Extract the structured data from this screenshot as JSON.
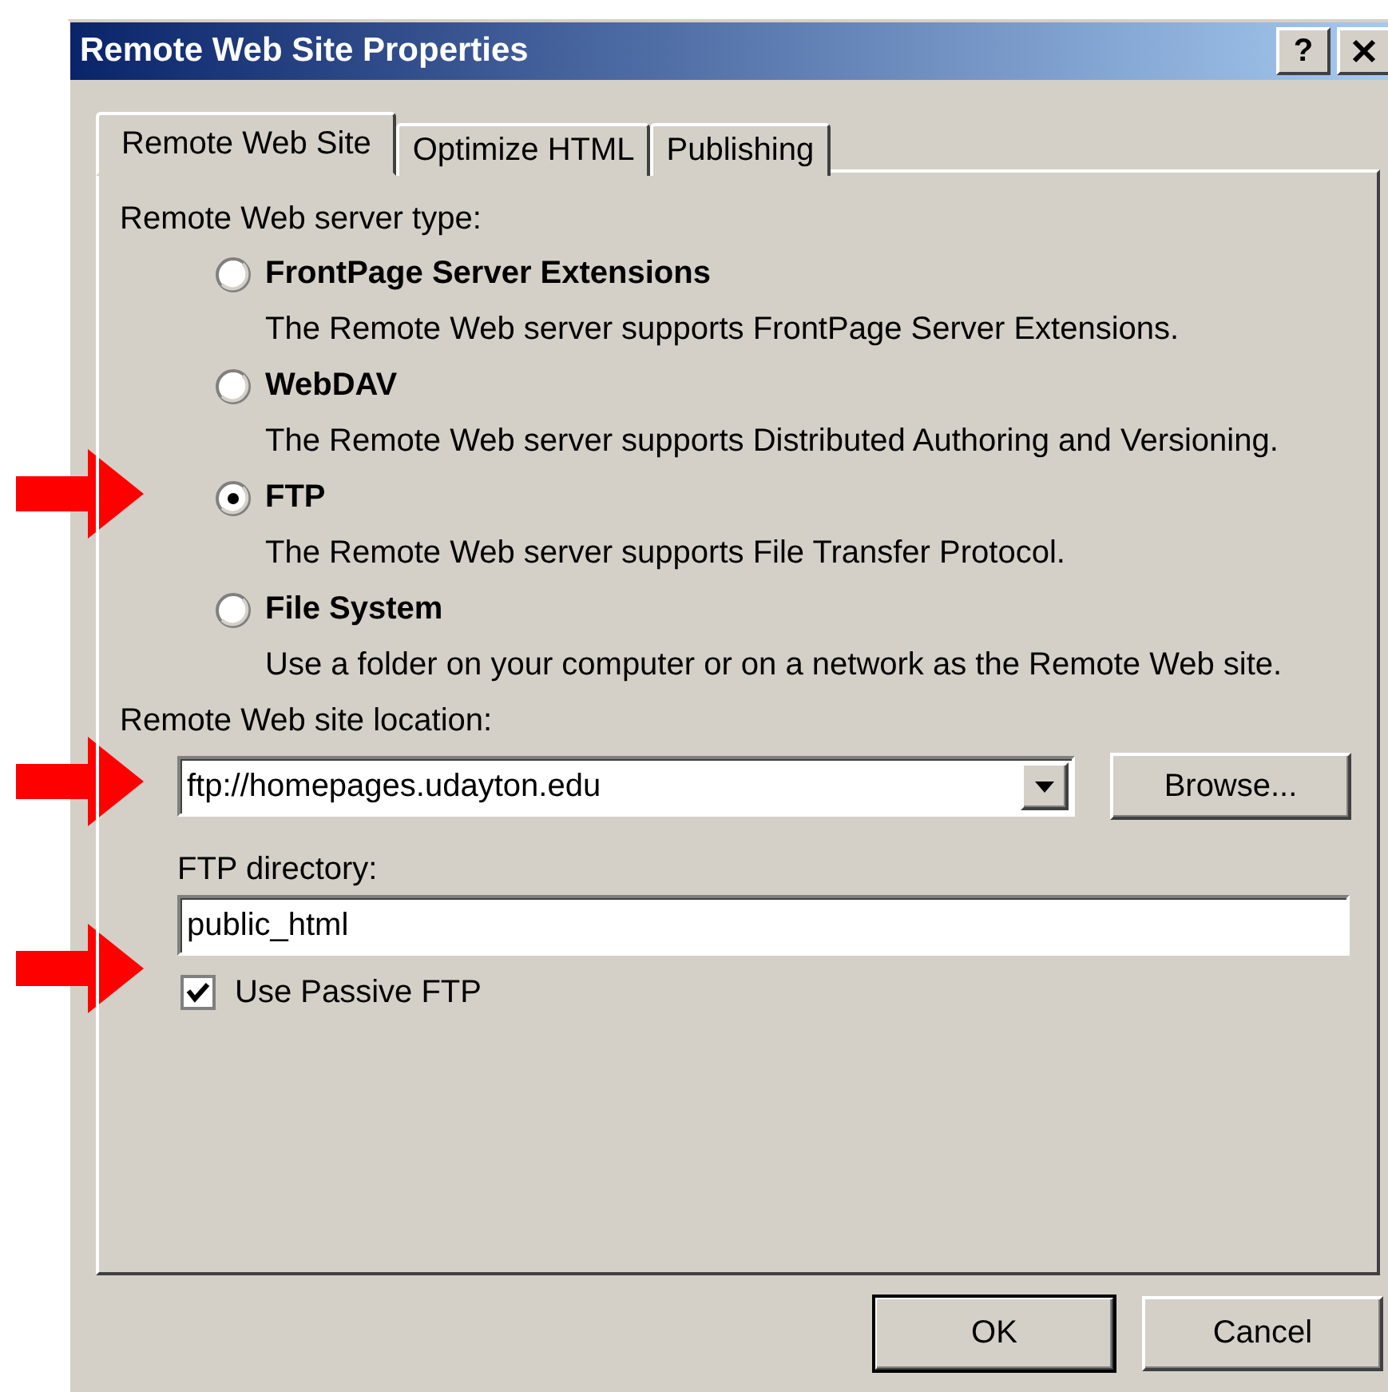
{
  "window": {
    "title": "Remote Web Site Properties",
    "help": "?"
  },
  "tabs": [
    {
      "label": "Remote Web Site",
      "selected": true
    },
    {
      "label": "Optimize HTML",
      "selected": false
    },
    {
      "label": "Publishing",
      "selected": false
    }
  ],
  "server_type": {
    "label": "Remote Web server type:",
    "options": [
      {
        "label": "FrontPage Server Extensions",
        "description": "The Remote Web server supports FrontPage Server Extensions.",
        "selected": false
      },
      {
        "label": "WebDAV",
        "description": "The Remote Web server supports Distributed Authoring and Versioning.",
        "selected": false
      },
      {
        "label": "FTP",
        "description": "The Remote Web server supports File Transfer Protocol.",
        "selected": true
      },
      {
        "label": "File System",
        "description": "Use a folder on your computer or on a network as the Remote Web site.",
        "selected": false
      }
    ]
  },
  "location": {
    "label": "Remote Web site location:",
    "value": "ftp://homepages.udayton.edu",
    "browse": "Browse..."
  },
  "ftp_directory": {
    "label": "FTP directory:",
    "value": "public_html"
  },
  "passive_ftp": {
    "label": "Use Passive FTP",
    "checked": true
  },
  "buttons": [
    {
      "label": "OK",
      "default": true
    },
    {
      "label": "Cancel",
      "default": false
    }
  ]
}
